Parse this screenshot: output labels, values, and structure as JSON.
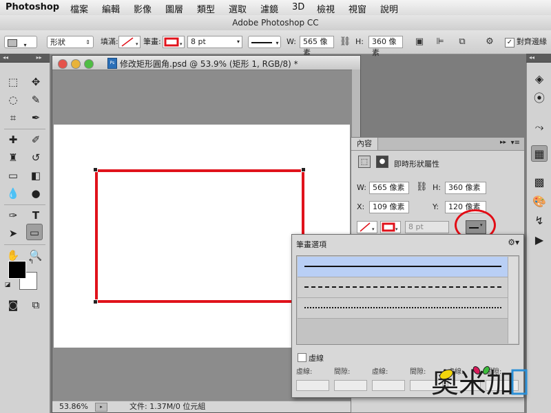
{
  "menubar": {
    "app": "Photoshop",
    "items": [
      "檔案",
      "編輯",
      "影像",
      "圖層",
      "類型",
      "選取",
      "濾鏡",
      "3D",
      "檢視",
      "視窗",
      "說明"
    ]
  },
  "window": {
    "title": "Adobe Photoshop CC"
  },
  "options": {
    "mode": "形狀",
    "fill_label": "填滿:",
    "stroke_label": "筆畫:",
    "stroke_width": "8 pt",
    "w_label": "W:",
    "w_value": "565 像素",
    "h_label": "H:",
    "h_value": "360 像素",
    "align_edges": "對齊邊緣"
  },
  "document": {
    "title": "修改矩形圓角.psd @ 53.9% (矩形 1, RGB/8) *",
    "zoom": "53.86%",
    "status": "文件: 1.37M/0 位元組"
  },
  "properties": {
    "tab": "內容",
    "subtitle": "即時形狀屬性",
    "w_label": "W:",
    "w_value": "565 像素",
    "h_label": "H:",
    "h_value": "360 像素",
    "x_label": "X:",
    "x_value": "109 像素",
    "y_label": "Y:",
    "y_value": "120 像素",
    "stroke_width": "8 pt"
  },
  "stroke_popup": {
    "title": "筆畫選項",
    "dashed_label": "虛線",
    "col_labels": [
      "虛線:",
      "間隙:",
      "虛線:",
      "間隙:",
      "虛線:",
      "間隙:"
    ]
  },
  "watermark": {
    "text": "奧米加"
  },
  "colors": {
    "accent_red": "#e0121b",
    "selection_blue": "#b9cff5"
  }
}
